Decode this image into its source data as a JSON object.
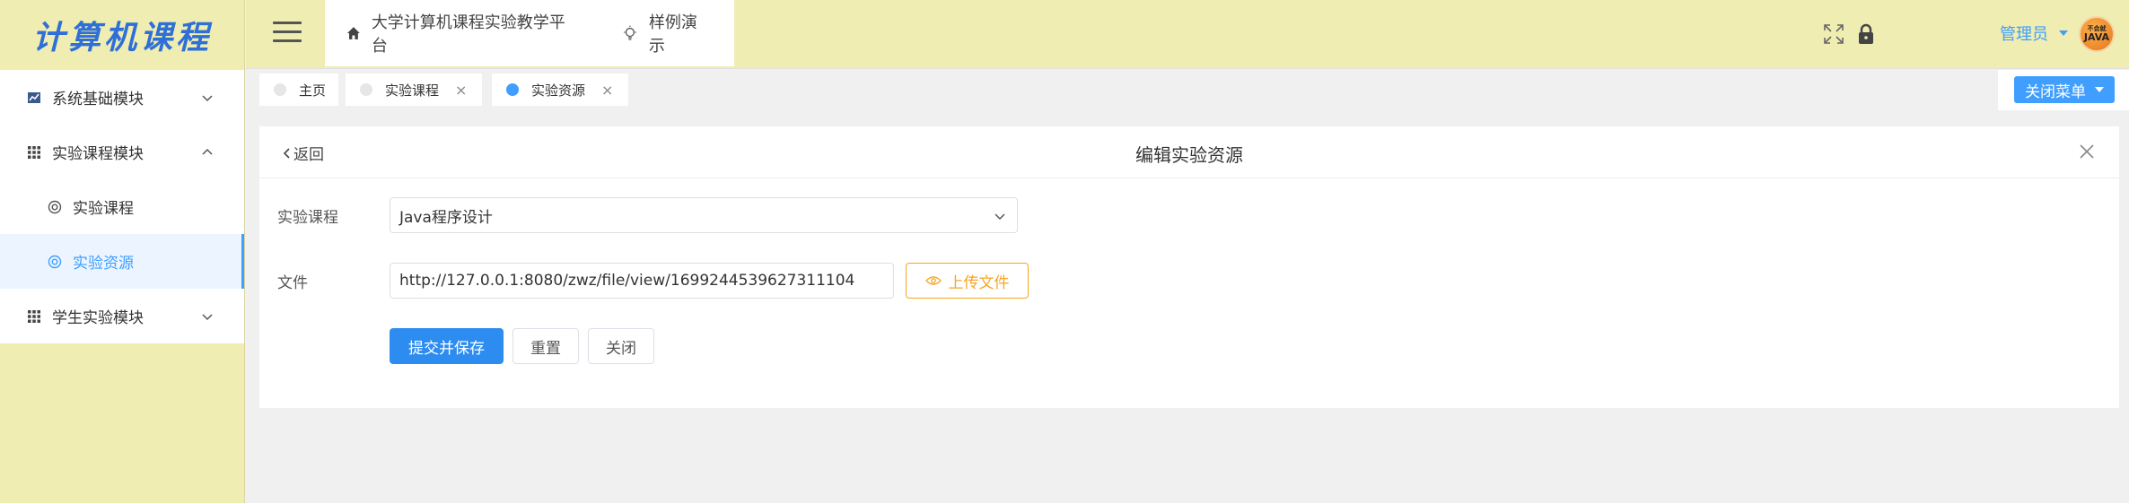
{
  "sidebar": {
    "logo": "计算机课程",
    "items": [
      {
        "label": "系统基础模块",
        "icon": "chart-icon",
        "expanded": false
      },
      {
        "label": "实验课程模块",
        "icon": "grid-icon",
        "expanded": true
      },
      {
        "label": "实验课程",
        "icon": "circle-icon"
      },
      {
        "label": "实验资源",
        "icon": "circle-icon",
        "active": true
      },
      {
        "label": "学生实验模块",
        "icon": "grid-icon",
        "expanded": false
      }
    ]
  },
  "header": {
    "nav": [
      {
        "label": "大学计算机课程实验教学平台",
        "icon": "home-icon"
      },
      {
        "label": "样例演示",
        "icon": "bulb-icon"
      }
    ],
    "user": "管理员",
    "avatar_top": "不会就",
    "avatar_brand": "JAVA"
  },
  "tabs": [
    {
      "label": "主页",
      "closable": false,
      "active": false
    },
    {
      "label": "实验课程",
      "closable": true,
      "active": false
    },
    {
      "label": "实验资源",
      "closable": true,
      "active": true
    }
  ],
  "tab_close_symbol": "×",
  "close_menu_label": "关闭菜单",
  "panel": {
    "back_label": "返回",
    "title": "编辑实验资源",
    "fields": {
      "course_label": "实验课程",
      "course_value": "Java程序设计",
      "file_label": "文件",
      "file_value": "http://127.0.0.1:8080/zwz/file/view/1699244539627311104",
      "upload_label": "上传文件"
    },
    "buttons": {
      "submit": "提交并保存",
      "reset": "重置",
      "close": "关闭"
    }
  },
  "colors": {
    "sidebar_bg": "#efedb1",
    "accent": "#409eff",
    "primary_button": "#2d8cf0",
    "upload_orange": "#f5a623"
  }
}
